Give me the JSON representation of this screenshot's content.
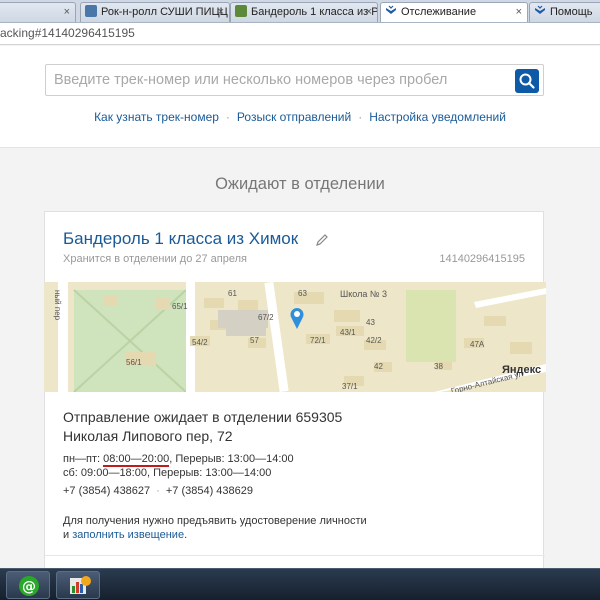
{
  "browser": {
    "tabs": [
      {
        "label": "Рок-н-ролл СУШИ ПИЦЦ",
        "icon": "vk-icon",
        "active": false
      },
      {
        "label": "Бандероль 1 класса из Р",
        "icon": "document-icon",
        "active": false
      },
      {
        "label": "Отслеживание",
        "icon": "russian-post-icon",
        "active": true
      },
      {
        "label": "Помощь",
        "icon": "russian-post-icon",
        "active": false
      }
    ],
    "close_glyph": "×",
    "url": "acking#14140296415195"
  },
  "header": {
    "search_placeholder": "Введите трек-номер или несколько номеров через пробел",
    "links": [
      "Как узнать трек-номер",
      "Розыск отправлений",
      "Настройка уведомлений"
    ],
    "link_separator": "·"
  },
  "section_title": "Ожидают в отделении",
  "parcel": {
    "title": "Бандероль 1 класса из Химок",
    "stored_until": "Хранится в отделении до 27 апреля",
    "track_number": "14140296415195",
    "map_labels": {
      "street_left": "ный пер",
      "school": "Школа № 3",
      "n61": "61",
      "n63": "63",
      "n65_1": "65/1",
      "n67_2": "67/2",
      "n54_2": "54/2",
      "n57": "57",
      "n43": "43",
      "n43_1": "43/1",
      "n72_1": "72/1",
      "n42_2": "42/2",
      "n42": "42",
      "n56_1": "56/1",
      "n37_1": "37/1",
      "n47a": "47А",
      "n38": "38",
      "street_right": "Горно-Алтайская ул",
      "yandex": "Яндекс"
    },
    "address_line1": "Отправление ожидает в отделении 659305",
    "address_line2": "Николая Липового пер, 72",
    "hours_weekday_prefix": "пн—пт: ",
    "hours_weekday_time": "08:00—20:00",
    "hours_weekday_break": ", Перерыв: 13:00—14:00",
    "hours_saturday": "сб: 09:00—18:00, Перерыв: 13:00—14:00",
    "phone1": "+7 (3854) 438627",
    "phone2": "+7 (3854) 438629",
    "phone_separator": "·",
    "note_line1": "Для получения нужно предъявить удостоверение личности",
    "note_prefix": "и ",
    "note_link": "заполнить извещение",
    "note_suffix": "."
  },
  "colors": {
    "link": "#1a5a96",
    "search_button": "#0e5aa7",
    "hours_underline": "#c21b1b",
    "map_pin": "#2f8fdc"
  }
}
